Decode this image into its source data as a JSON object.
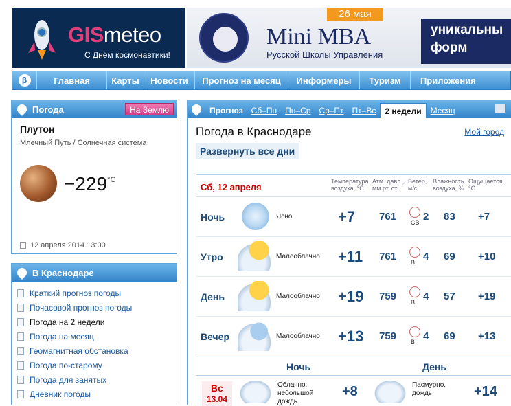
{
  "header": {
    "brand": "meteo",
    "brand_prefix": "GIS",
    "brand_sub": "С Днём космонавтики!",
    "ad": {
      "date": "26 мая",
      "title": "Mini MBA",
      "subtitle": "Русской Школы Управления",
      "promo": "уникальны форм"
    }
  },
  "nav": {
    "beta": "β",
    "items": [
      "Главная",
      "Карты",
      "Новости",
      "Прогноз на месяц",
      "Информеры",
      "Туризм",
      "Приложения"
    ]
  },
  "weather_panel": {
    "title": "Погода",
    "to_earth": "На Землю",
    "planet": "Плутон",
    "location": "Млечный Путь / Солнечная система",
    "temp": "−229",
    "unit": "°C",
    "date": "12 апреля 2014 13:00"
  },
  "city_panel": {
    "title": "В Краснодаре",
    "links": [
      "Краткий прогноз погоды",
      "Почасовой прогноз погоды",
      "Погода на 2 недели",
      "Погода на месяц",
      "Геомагнитная обстановка",
      "Погода по-старому",
      "Погода для занятых",
      "Дневник погоды"
    ],
    "active_index": 2
  },
  "forecast": {
    "tabs": [
      "Прогноз",
      "Сб–Пн",
      "Пн–Ср",
      "Ср–Пт",
      "Пт–Вс",
      "2 недели",
      "Месяц"
    ],
    "title": "Погода в Краснодаре",
    "my_city": "Мой город",
    "expand": "Развернуть все дни",
    "day": "Сб, 12 апреля",
    "columns": {
      "temp": "Температура воздуха, °C",
      "press": "Атм. давл., мм рт. ст.",
      "wind": "Ветер, м/с",
      "hum": "Влажность воздуха, %",
      "feel": "Ощущается, °C"
    },
    "rows": [
      {
        "tod": "Ночь",
        "icon": "moon-clear-icon",
        "desc": "Ясно",
        "temp": "+7",
        "press": "761",
        "wind_dir": "СВ",
        "wind": "2",
        "hum": "83",
        "feel": "+7"
      },
      {
        "tod": "Утро",
        "icon": "partly-cloudy-day-icon",
        "desc": "Малооблачно",
        "temp": "+11",
        "press": "761",
        "wind_dir": "В",
        "wind": "4",
        "hum": "69",
        "feel": "+10"
      },
      {
        "tod": "День",
        "icon": "partly-cloudy-day-icon",
        "desc": "Малооблачно",
        "temp": "+19",
        "press": "759",
        "wind_dir": "В",
        "wind": "4",
        "hum": "57",
        "feel": "+19"
      },
      {
        "tod": "Вечер",
        "icon": "partly-cloudy-night-icon",
        "desc": "Малооблачно",
        "temp": "+13",
        "press": "759",
        "wind_dir": "В",
        "wind": "4",
        "hum": "69",
        "feel": "+13"
      }
    ],
    "parts": {
      "night": "Ночь",
      "day": "День"
    },
    "next_day": {
      "dow": "Вс",
      "date": "13.04",
      "night_desc": "Облачно, небольшой дождь",
      "night_temp": "+8",
      "day_desc": "Пасмурно, дождь",
      "day_temp": "+14"
    }
  }
}
